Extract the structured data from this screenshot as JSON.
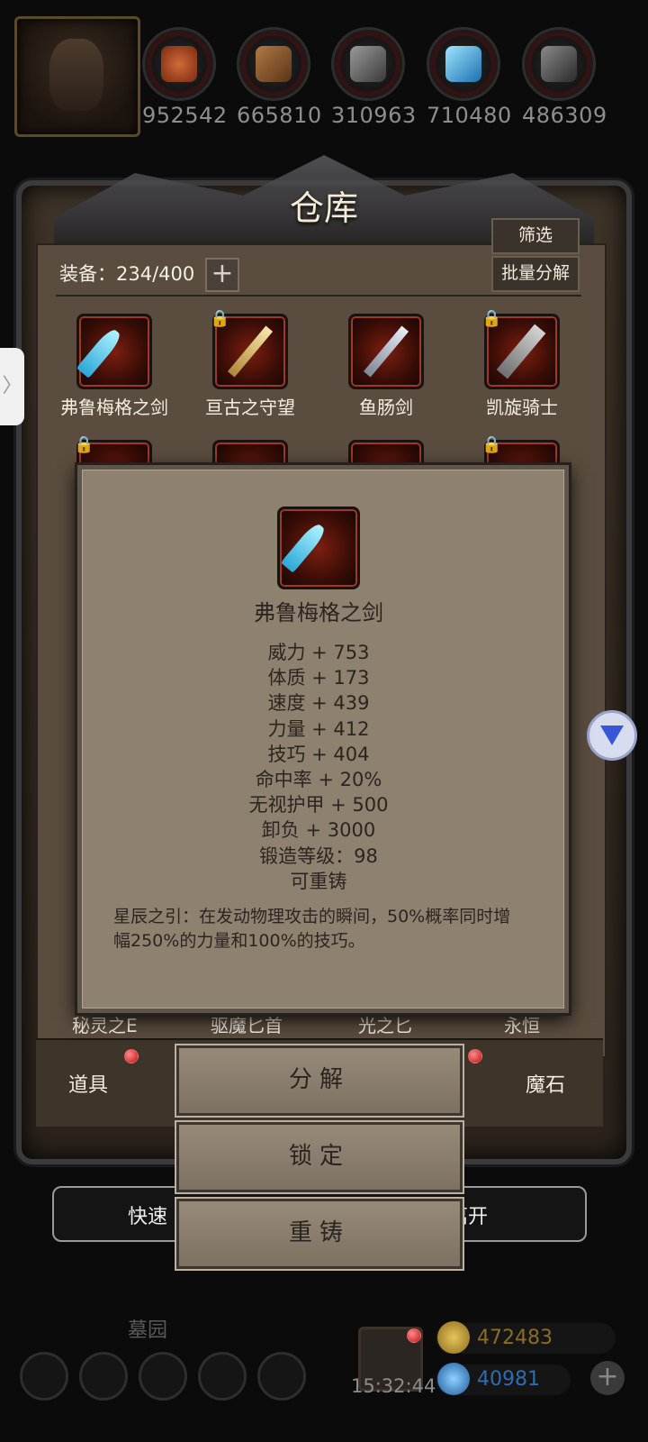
{
  "resources": [
    {
      "icon": "meat-icon",
      "value": "952542",
      "color": "#b4532a"
    },
    {
      "icon": "wood-icon",
      "value": "665810",
      "color": "#8a5a30"
    },
    {
      "icon": "iron-icon",
      "value": "310963",
      "color": "#6a6a6a"
    },
    {
      "icon": "crystal-icon",
      "value": "710480",
      "color": "#2f9bd6"
    },
    {
      "icon": "stone-icon",
      "value": "486309",
      "color": "#5a5a5a"
    }
  ],
  "warehouse": {
    "title": "仓库",
    "equip_count": "装备：234/400",
    "plus": "+",
    "filter_label": "筛选",
    "batch_label": "批量分解",
    "items_row1": [
      {
        "name": "弗鲁梅格之剑",
        "locked": false
      },
      {
        "name": "亘古之守望",
        "locked": true
      },
      {
        "name": "鱼肠剑",
        "locked": false
      },
      {
        "name": "凯旋骑士",
        "locked": true
      }
    ],
    "partial_row_labels": [
      "秘灵之E",
      "驱魔匕首",
      "光之匕",
      "永恒"
    ],
    "tabs": {
      "left": "道具",
      "right": "魔石"
    },
    "quick_left": "快速",
    "quick_right": "离开"
  },
  "tooltip": {
    "item_name": "弗鲁梅格之剑",
    "stats": [
      "威力 + 753",
      "体质 + 173",
      "速度 + 439",
      "力量 + 412",
      "技巧 + 404",
      "命中率 + 20%",
      "无视护甲 + 500",
      "卸负 + 3000",
      "锻造等级：98",
      "可重铸"
    ],
    "description": "星辰之引：在发动物理攻击的瞬间，50%概率同时增幅250%的力量和100%的技巧。"
  },
  "actions": {
    "decompose": "分解",
    "lock": "锁定",
    "reforge": "重铸"
  },
  "hud": {
    "cemetery": "墓园",
    "clock": "15:32:44",
    "gold": "472483",
    "gems": "40981"
  },
  "side_handle": "〉"
}
